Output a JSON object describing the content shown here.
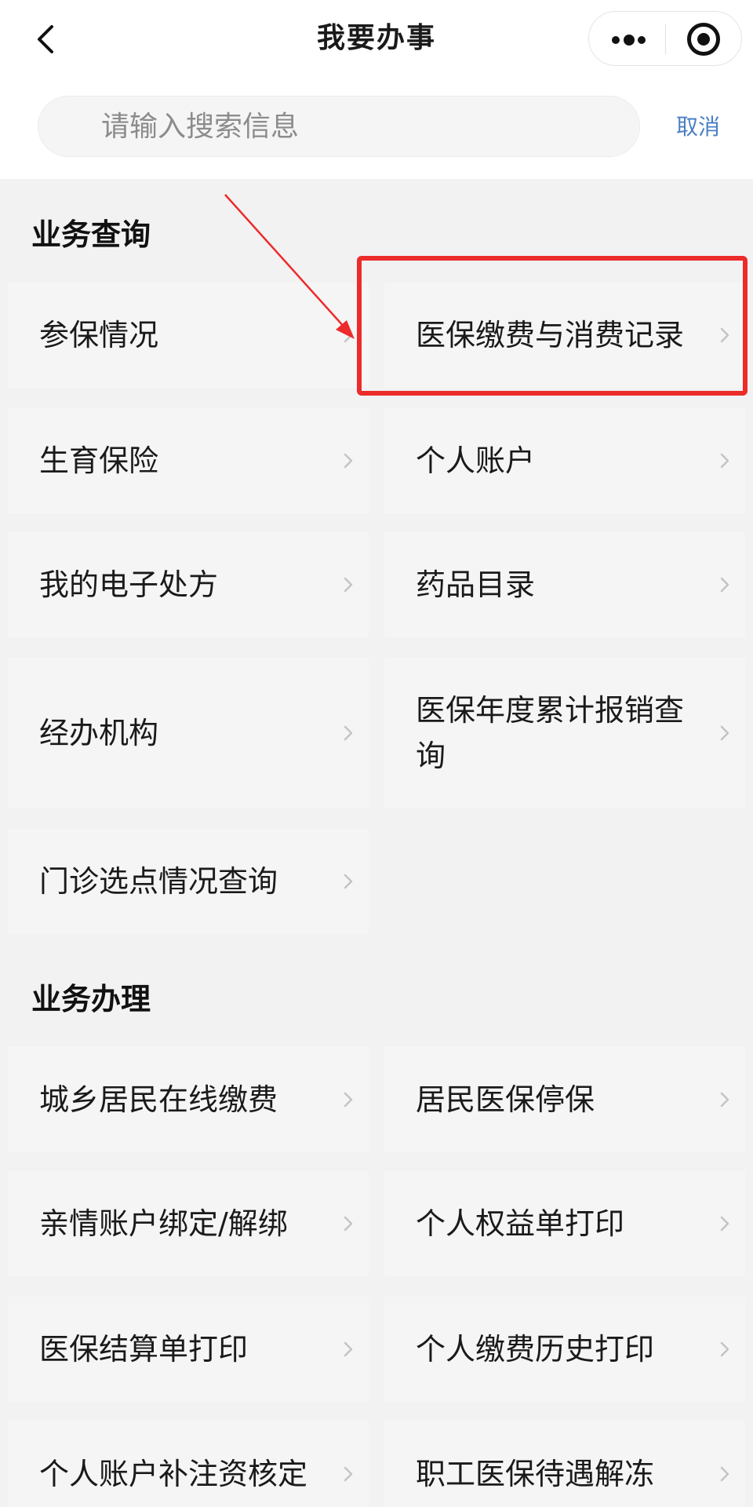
{
  "header": {
    "title": "我要办事",
    "back_icon": "chevron-left-icon",
    "more_icon": "more-dots-icon",
    "close_icon": "miniprogram-close-icon"
  },
  "search": {
    "placeholder": "请输入搜索信息",
    "cancel_label": "取消"
  },
  "sections": {
    "query": {
      "title": "业务查询",
      "items": [
        {
          "label": "参保情况"
        },
        {
          "label": "医保缴费与消费记录"
        },
        {
          "label": "生育保险"
        },
        {
          "label": "个人账户"
        },
        {
          "label": "我的电子处方"
        },
        {
          "label": "药品目录"
        },
        {
          "label": "经办机构"
        },
        {
          "label": "医保年度累计报销查询"
        },
        {
          "label": "门诊选点情况查询"
        }
      ]
    },
    "process": {
      "title": "业务办理",
      "items": [
        {
          "label": "城乡居民在线缴费"
        },
        {
          "label": "居民医保停保"
        },
        {
          "label": "亲情账户绑定/解绑"
        },
        {
          "label": "个人权益单打印"
        },
        {
          "label": "医保结算单打印"
        },
        {
          "label": "个人缴费历史打印"
        },
        {
          "label": "个人账户补注资核定"
        },
        {
          "label": "职工医保待遇解冻"
        }
      ]
    }
  },
  "colors": {
    "annotation": "#ec2b2b",
    "link": "#4a7fc4",
    "section_bg": "#f2f2f2",
    "cell_bg": "#f5f5f5"
  }
}
